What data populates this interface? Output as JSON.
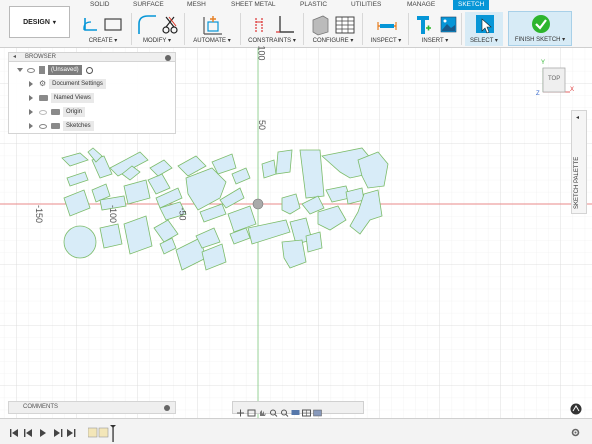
{
  "ribbon": {
    "workspace_label": "DESIGN",
    "tabs": [
      "SOLID",
      "SURFACE",
      "MESH",
      "SHEET METAL",
      "PLASTIC",
      "UTILITIES",
      "MANAGE",
      "SKETCH"
    ],
    "active_tab": "SKETCH",
    "groups": {
      "create": "CREATE ▾",
      "modify": "MODIFY ▾",
      "automate": "AUTOMATE ▾",
      "constraints": "CONSTRAINTS ▾",
      "configure": "CONFIGURE ▾",
      "inspect": "INSPECT ▾",
      "insert": "INSERT ▾",
      "select": "SELECT ▾",
      "finish": "FINISH SKETCH ▾"
    },
    "accent": "#0696d7",
    "finish_color": "#2db52d"
  },
  "browser": {
    "title": "BROWSER",
    "items": [
      {
        "label": "(Unsaved)"
      },
      {
        "label": "Document Settings"
      },
      {
        "label": "Named Views"
      },
      {
        "label": "Origin"
      },
      {
        "label": "Sketches"
      }
    ]
  },
  "viewcube": {
    "face": "TOP",
    "axes": {
      "y": "Y",
      "x": "X",
      "z": "Z"
    }
  },
  "sketch_palette": {
    "label": "SKETCH PALETTE"
  },
  "comments": {
    "label": "COMMENTS"
  },
  "canvas": {
    "axis_labels": {
      "y100": "100",
      "y50": "50",
      "xm150": "-150",
      "xm100": "-100",
      "xm50": "-50"
    },
    "grid_color": "#e6e6e6",
    "red_axis": "#e88a8a",
    "green_axis": "#8dcf8d",
    "sketch_fill": "#d8ecf8",
    "sketch_stroke": "#7cbc6a"
  }
}
